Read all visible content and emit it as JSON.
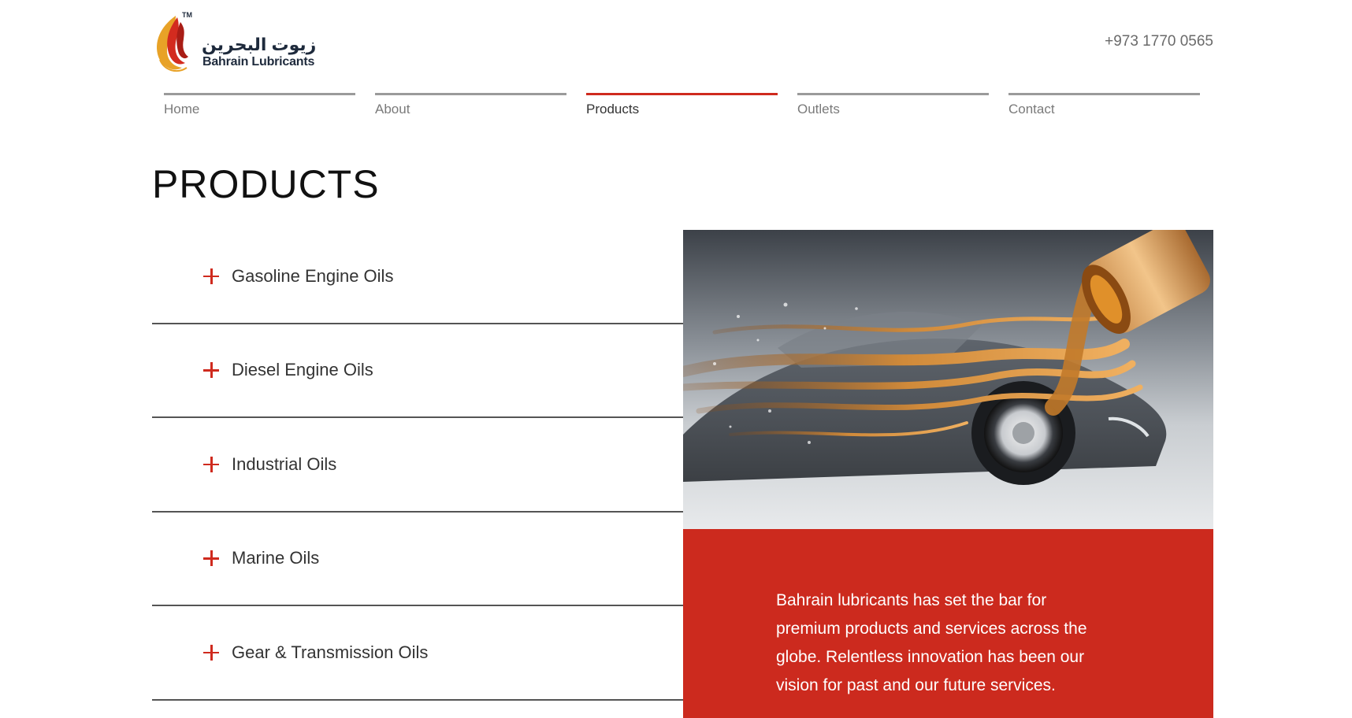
{
  "header": {
    "logo_arabic": "زيوت البحرين",
    "logo_english": "Bahrain Lubricants",
    "logo_tm": "TM",
    "phone": "+973 1770 0565"
  },
  "nav": {
    "items": [
      {
        "label": "Home",
        "active": false
      },
      {
        "label": "About",
        "active": false
      },
      {
        "label": "Products",
        "active": true
      },
      {
        "label": "Outlets",
        "active": false
      },
      {
        "label": "Contact",
        "active": false
      }
    ]
  },
  "main": {
    "title": "PRODUCTS",
    "categories": [
      "Gasoline Engine Oils",
      "Diesel Engine Oils",
      "Industrial Oils",
      "Marine Oils",
      "Gear & Transmission Oils"
    ],
    "description": "Bahrain lubricants has set the bar for premium products and services across the globe. Relentless innovation has been our vision for past and our future services."
  },
  "colors": {
    "accent": "#cf2a1e",
    "info_background": "#cc2a1e",
    "nav_inactive": "#9a9a9a"
  }
}
